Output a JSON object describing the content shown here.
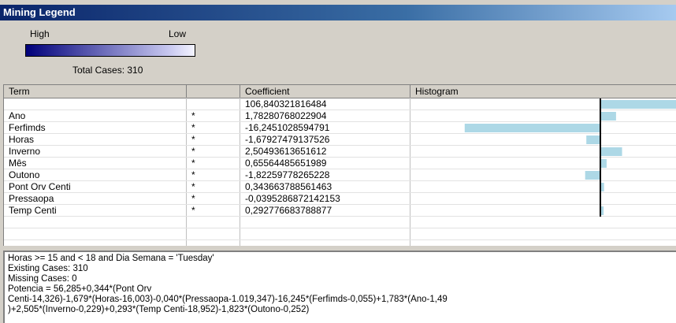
{
  "window": {
    "title": "Mining Legend"
  },
  "legend": {
    "high_label": "High",
    "low_label": "Low",
    "total_cases": "Total Cases:  310"
  },
  "columns": [
    "Term",
    "",
    "Coefficient",
    "Histogram"
  ],
  "rows": [
    {
      "term": "",
      "star": "",
      "coef": "106,840321816484",
      "value": 106.840321816484
    },
    {
      "term": "Ano",
      "star": "*",
      "coef": "1,78280768022904",
      "value": 1.78280768022904
    },
    {
      "term": "Ferfimds",
      "star": "*",
      "coef": "-16,2451028594791",
      "value": -16.2451028594791
    },
    {
      "term": "Horas",
      "star": "*",
      "coef": "-1,67927479137526",
      "value": -1.67927479137526
    },
    {
      "term": "Inverno",
      "star": "*",
      "coef": "2,50493613651612",
      "value": 2.50493613651612
    },
    {
      "term": "Mês",
      "star": "*",
      "coef": "0,65564485651989",
      "value": 0.65564485651989
    },
    {
      "term": "Outono",
      "star": "*",
      "coef": "-1,82259778265228",
      "value": -1.82259778265228
    },
    {
      "term": "Pont Orv Centi",
      "star": "*",
      "coef": "0,343663788561463",
      "value": 0.343663788561463
    },
    {
      "term": "Pressaopa",
      "star": "*",
      "coef": "-0,0395286872142153",
      "value": -0.0395286872142153
    },
    {
      "term": "Temp Centi",
      "star": "*",
      "coef": "0,292776683788877",
      "value": 0.292776683788877
    }
  ],
  "empty_rows": 3,
  "histogram_color": "#add8e6",
  "details": {
    "line1": "Horas >= 15 and < 18 and Dia Semana = 'Tuesday'",
    "line2": "Existing Cases: 310",
    "line3": "Missing Cases: 0",
    "line4": "Potencia = 56,285+0,344*(Pont Orv",
    "line5": "Centi-14,326)-1,679*(Horas-16,003)-0,040*(Pressaopa-1.019,347)-16,245*(Ferfimds-0,055)+1,783*(Ano-1,49",
    "line6": ")+2,505*(Inverno-0,229)+0,293*(Temp Centi-18,952)-1,823*(Outono-0,252)"
  }
}
